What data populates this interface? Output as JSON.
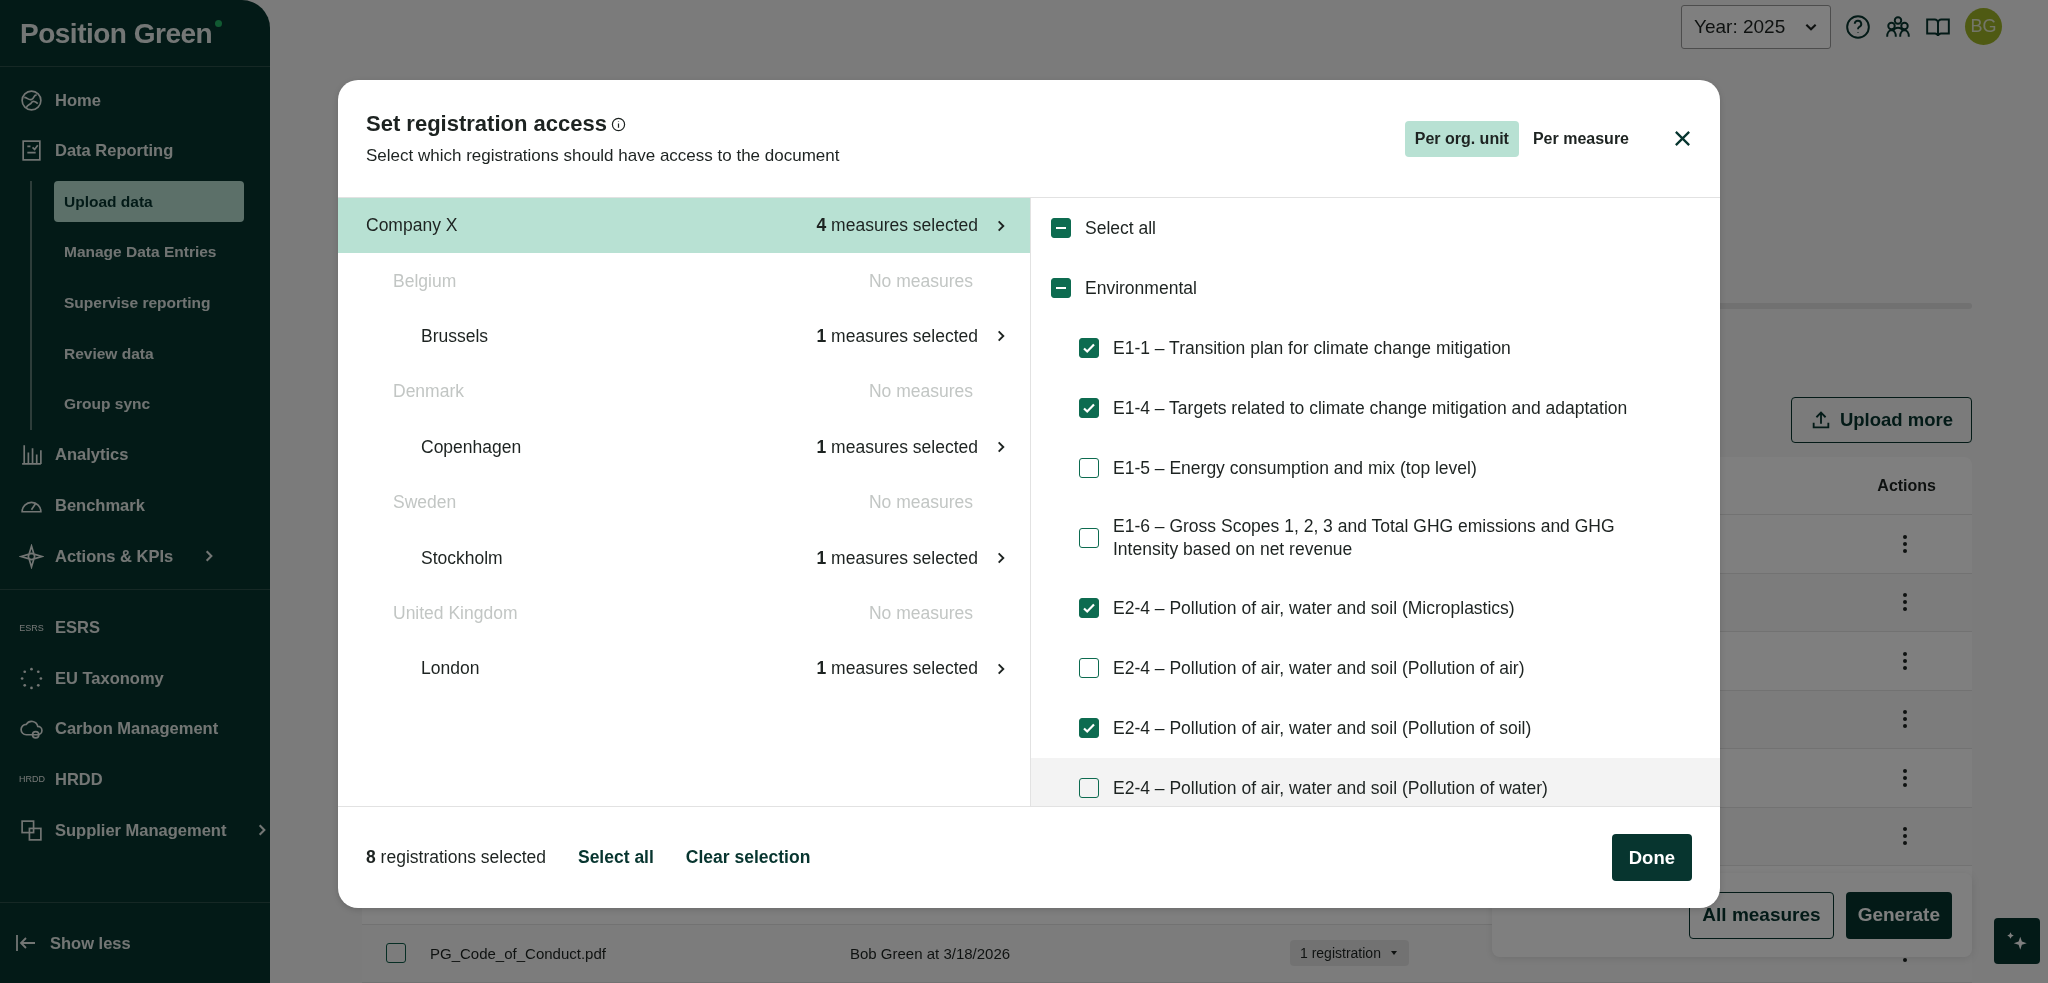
{
  "sidebar": {
    "logo": "Position Green",
    "items": [
      {
        "label": "Home",
        "has_submenu": false
      },
      {
        "label": "Data Reporting",
        "has_submenu": false,
        "children": [
          {
            "label": "Upload data",
            "selected": true
          },
          {
            "label": "Manage Data Entries",
            "selected": false
          },
          {
            "label": "Supervise reporting",
            "selected": false
          },
          {
            "label": "Review data",
            "selected": false
          },
          {
            "label": "Group sync",
            "selected": false
          }
        ]
      },
      {
        "label": "Analytics",
        "has_submenu": false
      },
      {
        "label": "Benchmark",
        "has_submenu": false
      },
      {
        "label": "Actions & KPIs",
        "has_submenu": true
      }
    ],
    "items_2": [
      {
        "label": "ESRS",
        "badge": "ESRS",
        "has_submenu": false
      },
      {
        "label": "EU Taxonomy",
        "has_submenu": false
      },
      {
        "label": "Carbon Management",
        "has_submenu": false
      },
      {
        "label": "HRDD",
        "badge": "HRDD",
        "has_submenu": false
      },
      {
        "label": "Supplier Management",
        "has_submenu": true
      }
    ],
    "show_less": "Show less"
  },
  "topbar": {
    "year": "Year: 2025",
    "avatar": "BG"
  },
  "upload_button": "Upload more",
  "table": {
    "columns": [
      "Actions"
    ],
    "rows": [
      {
        "kind": "covered"
      },
      {
        "kind": "covered"
      },
      {
        "kind": "covered"
      },
      {
        "kind": "covered"
      },
      {
        "kind": "covered"
      },
      {
        "kind": "covered"
      },
      {
        "kind": "blank"
      },
      {
        "kind": "file",
        "checked": false,
        "file": "PG_Code_of_Conduct.pdf",
        "uploaded": "Bob Green at 3/18/2026",
        "registrations": "1 registration"
      }
    ]
  },
  "generate_bar": {
    "buttons": [
      "All measures",
      "Generate"
    ]
  },
  "dialog": {
    "title": "Set registration access",
    "subtitle": "Select which registrations should have access to the document",
    "modes": [
      {
        "label": "Per org. unit",
        "selected": true
      },
      {
        "label": "Per measure",
        "selected": false
      }
    ],
    "org_units": [
      {
        "name": "Company X",
        "count": "**4** measures selected",
        "selected": true,
        "disabled": false,
        "children": [
          {
            "name": "Belgium",
            "count": "No measures",
            "selected": false,
            "disabled": true,
            "children": [
              {
                "name": "Brussels",
                "count": "**1** measures selected",
                "selected": false,
                "disabled": false
              }
            ]
          },
          {
            "name": "Denmark",
            "count": "No measures",
            "selected": false,
            "disabled": true,
            "children": [
              {
                "name": "Copenhagen",
                "count": "**1** measures selected",
                "selected": false,
                "disabled": false
              }
            ]
          },
          {
            "name": "Sweden",
            "count": "No measures",
            "selected": false,
            "disabled": true,
            "children": [
              {
                "name": "Stockholm",
                "count": "**1** measures selected",
                "selected": false,
                "disabled": false
              }
            ]
          },
          {
            "name": "United Kingdom",
            "count": "No measures",
            "selected": false,
            "disabled": true,
            "children": [
              {
                "name": "London",
                "count": "**1** measures selected",
                "selected": false,
                "disabled": false
              }
            ]
          }
        ]
      }
    ],
    "select_all": {
      "label": "Select all",
      "mixed": true
    },
    "groups": [
      {
        "label": "Environmental",
        "mixed": true,
        "items": [
          {
            "label": "E1-1 – Transition plan for climate change mitigation",
            "checked": true,
            "highlighted": false
          },
          {
            "label": "E1-4 – Targets related to climate change mitigation and adaptation",
            "checked": true,
            "highlighted": false
          },
          {
            "label": "E1-5 – Energy consumption and mix (top level)",
            "checked": false,
            "highlighted": false
          },
          {
            "label": "E1-6 – Gross Scopes 1, 2, 3 and Total GHG emissions and GHG Intensity based on net revenue",
            "checked": false,
            "highlighted": false
          },
          {
            "label": "E2-4 – Pollution of air, water and soil (Microplastics)",
            "checked": true,
            "highlighted": false
          },
          {
            "label": "E2-4 – Pollution of air, water and soil (Pollution of air)",
            "checked": false,
            "highlighted": false
          },
          {
            "label": "E2-4 – Pollution of air, water and soil (Pollution of soil)",
            "checked": true,
            "highlighted": false
          },
          {
            "label": "E2-4 – Pollution of air, water and soil (Pollution of water)",
            "checked": false,
            "highlighted": true
          }
        ]
      }
    ],
    "footer": {
      "summary": "**8** registrations selected",
      "links": [
        "Select all",
        "Clear selection"
      ],
      "done": "Done"
    }
  }
}
